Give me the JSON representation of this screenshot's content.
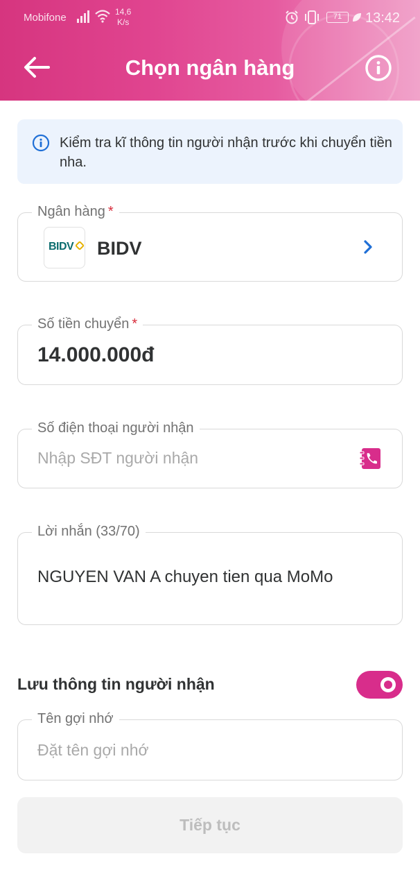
{
  "status_bar": {
    "carrier": "Mobifone",
    "speed_value": "14,6",
    "speed_unit": "K/s",
    "battery": "71",
    "time": "13:42"
  },
  "header": {
    "title": "Chọn ngân hàng",
    "back_icon": "arrow-left-icon",
    "info_icon": "info-circle-icon"
  },
  "notice": {
    "text": "Kiểm tra kĩ thông tin người nhận trước khi chuyển tiền nha."
  },
  "bank_field": {
    "label": "Ngân hàng",
    "required_mark": "*",
    "logo_text": "BIDV",
    "bank_name": "BIDV"
  },
  "amount_field": {
    "label": "Số tiền chuyển",
    "required_mark": "*",
    "value": "14.000.000đ"
  },
  "phone_field": {
    "label": "Số điện thoại người nhận",
    "placeholder": "Nhập SĐT người nhận"
  },
  "message_field": {
    "label": "Lời nhắn (33/70)",
    "value": "NGUYEN VAN A chuyen tien qua MoMo"
  },
  "save_recipient": {
    "label": "Lưu thông tin người nhận",
    "enabled": true
  },
  "nickname_field": {
    "label": "Tên gợi nhớ",
    "placeholder": "Đặt tên gợi nhớ"
  },
  "continue_button": {
    "label": "Tiếp tục"
  },
  "colors": {
    "brand": "#d82d8b",
    "required": "#d82d3c",
    "link_blue": "#1f6fd6",
    "notice_bg": "#ecf3fd"
  }
}
